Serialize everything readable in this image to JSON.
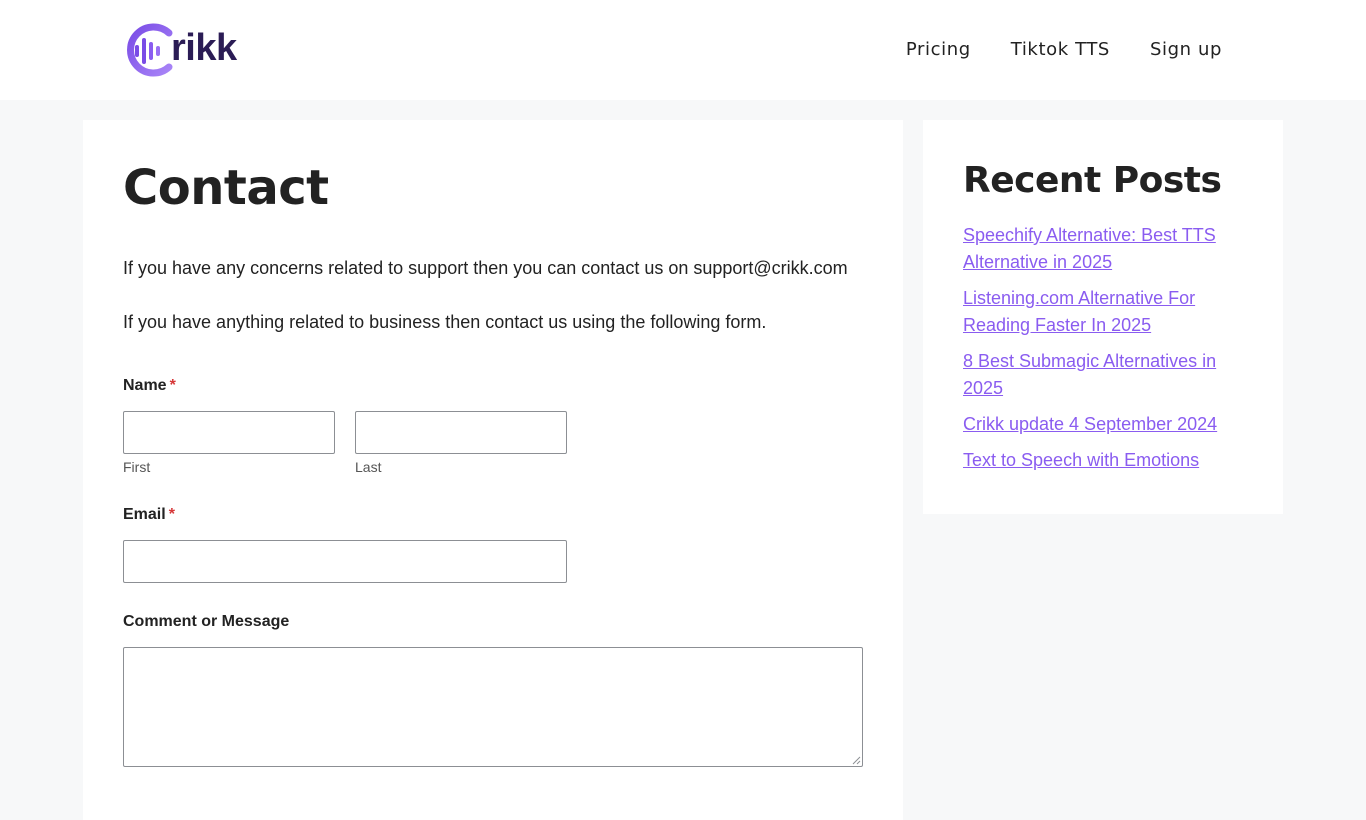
{
  "header": {
    "logo_text": "rikk",
    "nav": [
      "Pricing",
      "Tiktok TTS",
      "Sign up"
    ]
  },
  "colors": {
    "brand_purple": "#8a5cf0",
    "logo_dark": "#2b1c55",
    "required_red": "#d63637",
    "page_bg": "#f7f8f9"
  },
  "main": {
    "title": "Contact",
    "para1": "If you have any concerns related to support then you can contact us on support@crikk.com",
    "para2": "If you have anything related to business then contact us using the following form.",
    "form": {
      "name_label": "Name",
      "required_mark": "*",
      "first_sublabel": "First",
      "last_sublabel": "Last",
      "first_value": "",
      "last_value": "",
      "email_label": "Email",
      "email_value": "",
      "message_label": "Comment or Message",
      "message_value": ""
    }
  },
  "sidebar": {
    "title": "Recent Posts",
    "posts": [
      "Speechify Alternative: Best TTS Alternative in 2025",
      "Listening.com Alternative For Reading Faster In 2025",
      "8 Best Submagic Alternatives in 2025",
      "Crikk update 4 September 2024",
      "Text to Speech with Emotions"
    ]
  },
  "icons": {
    "logo_mark": "sound-wave-c-icon",
    "textarea_grip": "resize-grip-icon"
  }
}
